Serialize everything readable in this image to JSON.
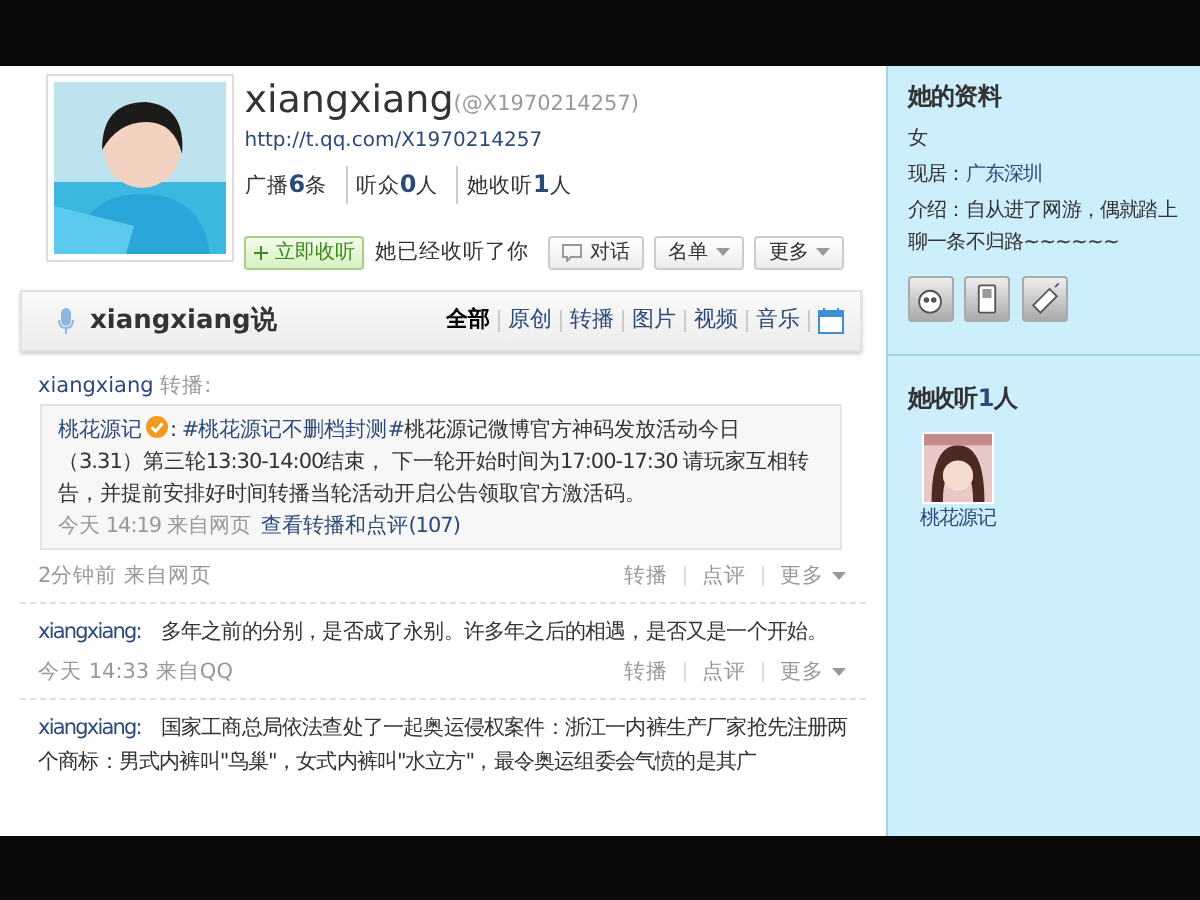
{
  "profile": {
    "name": "xiangxiang",
    "handle": "(@X1970214257)",
    "url": "http://t.qq.com/X1970214257",
    "stats": [
      {
        "label": "广播",
        "count": "6",
        "unit": "条"
      },
      {
        "label": "听众",
        "count": "0",
        "unit": "人"
      },
      {
        "label": "她收听",
        "count": "1",
        "unit": "人"
      }
    ],
    "follow_button": "立即收听",
    "status_text": "她已经收听了你",
    "actions": [
      {
        "label": "对话",
        "kind": "chat"
      },
      {
        "label": "名单",
        "kind": "dropdown"
      },
      {
        "label": "更多",
        "kind": "dropdown"
      }
    ]
  },
  "timeline": {
    "title": "xiangxiang说",
    "filters": [
      {
        "label": "全部",
        "selected": true
      },
      {
        "label": "原创",
        "selected": false
      },
      {
        "label": "转播",
        "selected": false
      },
      {
        "label": "图片",
        "selected": false
      },
      {
        "label": "视频",
        "selected": false
      },
      {
        "label": "音乐",
        "selected": false
      }
    ]
  },
  "posts": [
    {
      "kind": "repost",
      "author": "xiangxiang",
      "verb": "转播:",
      "quote": {
        "author": "桃花源记",
        "verified": true,
        "separator": ":",
        "hashtag": "#桃花源记不删档封测#",
        "text": "桃花源记微博官方神码发放活动今日（3.31）第三轮13:30-14:00结束， 下一轮开始时间为17:00-17:30 请玩家互相转告，并提前安排好时间转播当轮活动开启公告领取官方激活码。",
        "time": "今天 14:19 来自网页",
        "link": "查看转播和点评(107)"
      },
      "time": "2分钟前 来自网页",
      "actions": [
        {
          "label": "转播",
          "dropdown": false
        },
        {
          "label": "点评",
          "dropdown": false
        },
        {
          "label": "更多",
          "dropdown": true
        }
      ]
    },
    {
      "kind": "original",
      "author": "xiangxiang:",
      "text": "多年之前的分别，是否成了永别。许多年之后的相遇，是否又是一个开始。",
      "time": "今天 14:33 来自QQ",
      "actions": [
        {
          "label": "转播",
          "dropdown": false
        },
        {
          "label": "点评",
          "dropdown": false
        },
        {
          "label": "更多",
          "dropdown": true
        }
      ]
    },
    {
      "kind": "original",
      "author": "xiangxiang:",
      "text": "国家工商总局依法查处了一起奥运侵权案件：浙江一内裤生产厂家抢先注册两个商标：男式内裤叫\"鸟巢\"，女式内裤叫\"水立方\"，最令奥运组委会气愤的是其广"
    }
  ],
  "sidebar": {
    "profile_title": "她的资料",
    "gender": "女",
    "location_label": "现居：",
    "location": "广东深圳",
    "intro_label": "介绍：",
    "intro": "自从进了网游，偶就踏上聊一条不归路~~~~~~",
    "following_title": "她收听",
    "following_count": "1",
    "following_unit": "人",
    "following": [
      {
        "name": "桃花源记"
      }
    ]
  }
}
